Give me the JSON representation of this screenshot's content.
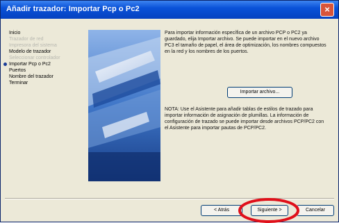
{
  "window": {
    "title": "Añadir trazador: Importar Pcp o Pc2",
    "close_glyph": "×"
  },
  "steps": [
    {
      "label": "Inicio",
      "state": "done"
    },
    {
      "label": "Trazador de red",
      "state": "disabled"
    },
    {
      "label": "Impresora del sistema",
      "state": "disabled"
    },
    {
      "label": "Modelo de trazador",
      "state": "done"
    },
    {
      "label": "Seleccionar controlador",
      "state": "disabled"
    },
    {
      "label": "Importar Pcp o Pc2",
      "state": "current"
    },
    {
      "label": "Puertos",
      "state": "pending"
    },
    {
      "label": "Nombre del trazador",
      "state": "pending"
    },
    {
      "label": "Terminar",
      "state": "pending"
    }
  ],
  "description": "Para importar información específica de un archivo PCP o PC2 ya guardado, elija Importar archivo. Se puede importar en el nuevo archivo PC3 el tamaño de papel, el área de optimización, los nombres compuestos en la red y los nombres de los puertos.",
  "import_button": "Importar archivo...",
  "note": "NOTA: Use el Asistente para añadir tablas de estilos de trazado para importar información de asignación de plumillas. La información de configuración de trazado se puede importar desde archivos PCP/PC2 con el Asistente para importar pautas de PCP/PC2.",
  "buttons": {
    "back": "< Atrás",
    "next": "Siguiente >",
    "cancel": "Cancelar"
  },
  "colors": {
    "titlebar": "#0a52d8",
    "highlight": "#e0101a"
  }
}
